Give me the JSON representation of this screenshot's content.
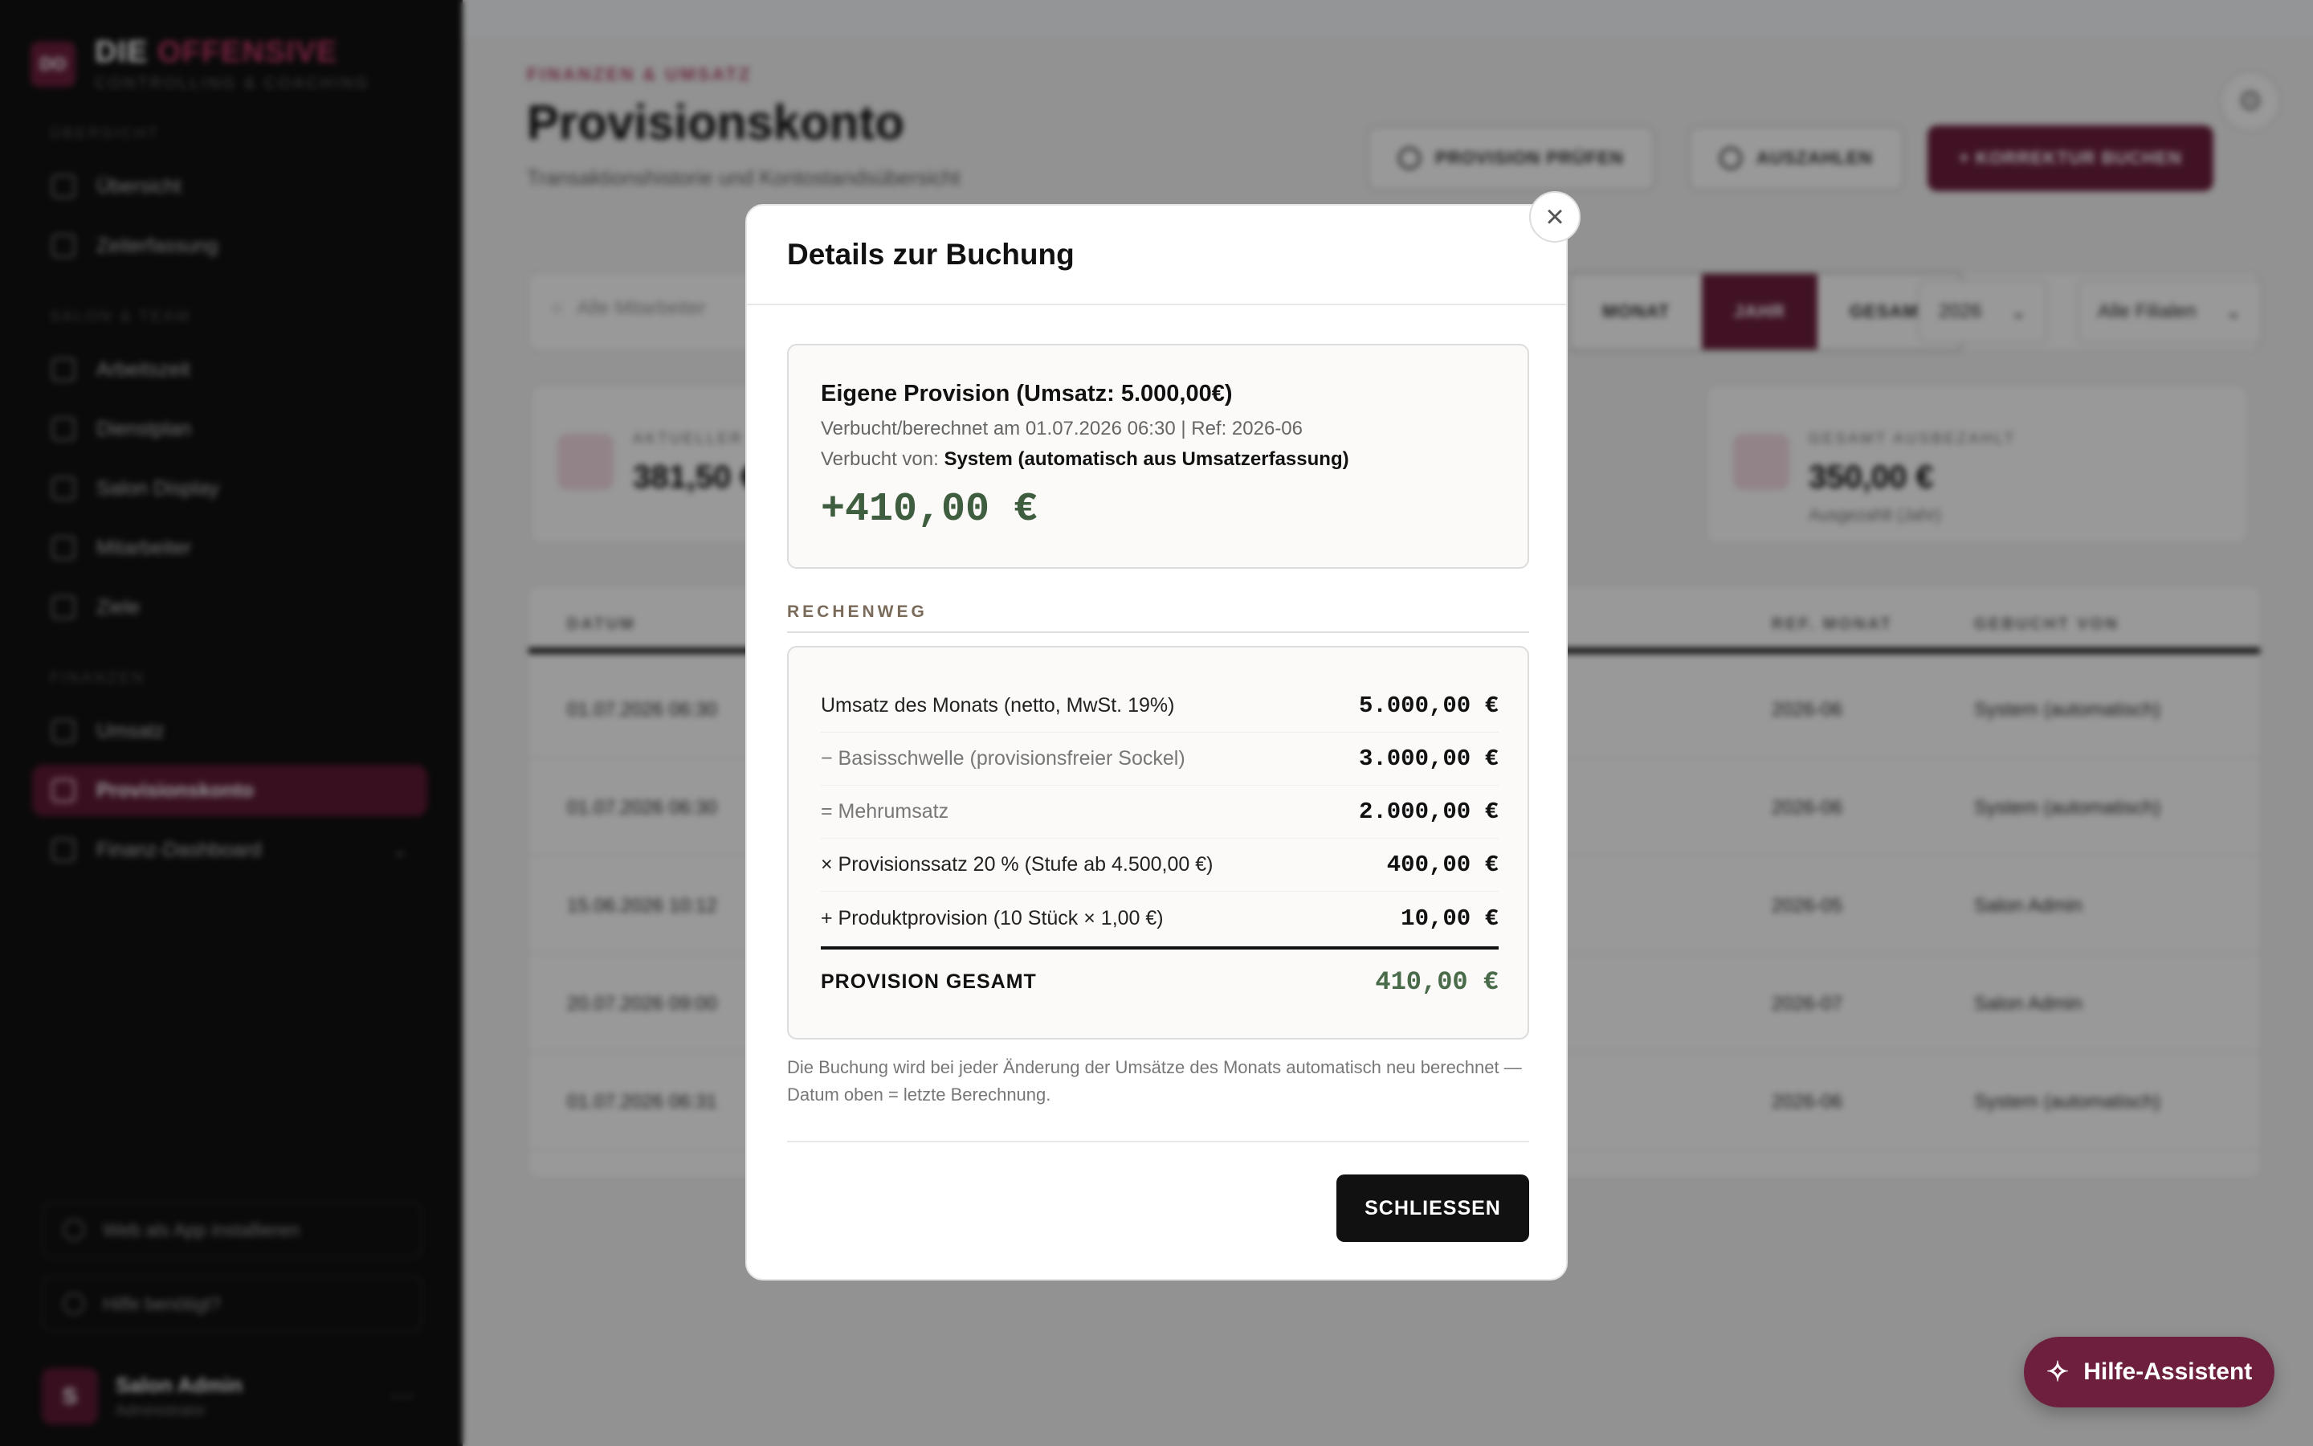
{
  "sidebar": {
    "logo_mark": "DO",
    "logo_word1": "DIE",
    "logo_word2": "OFFENSIVE",
    "logo_sub": "CONTROLLING & COACHING",
    "section1": "ÜBERSICHT",
    "section2": "SALON & TEAM",
    "section3": "FINANZEN",
    "items": [
      {
        "label": "Übersicht"
      },
      {
        "label": "Zeiterfassung"
      },
      {
        "label": "Arbeitszeit"
      },
      {
        "label": "Dienstplan"
      },
      {
        "label": "Salon Display"
      },
      {
        "label": "Mitarbeiter"
      },
      {
        "label": "Ziele"
      },
      {
        "label": "Umsatz"
      },
      {
        "label": "Provisionskonto"
      },
      {
        "label": "Finanz-Dashboard"
      }
    ],
    "install_label": "Web als App installieren",
    "help_label": "Hilfe benötigt?",
    "user_initial": "S",
    "user_name": "Salon Admin",
    "user_role": "Administrator"
  },
  "main": {
    "breadcrumb": "FINANZEN & UMSATZ",
    "title": "Provisionskonto",
    "subtitle": "Transaktionshistorie und Kontostandsübersicht",
    "btn_check": "PROVISION PRÜFEN",
    "btn_payout": "AUSZAHLEN",
    "btn_correction": "+ KORREKTUR BUCHEN",
    "search_placeholder": "Alle Mitarbeiter",
    "seg_left": "MONAT",
    "seg_active": "JAHR",
    "seg_right": "GESAMT",
    "year": "2026",
    "branch": "Alle Filialen",
    "kpi1_label": "AKTUELLER KONTOSTAND",
    "kpi1_value": "381,50 €",
    "kpi2_label": "GESAMT AUSBEZAHLT",
    "kpi2_value": "350,00 €",
    "kpi2_hint": "Ausgezahlt (Jahr)",
    "columns": [
      "DATUM",
      "REF. MONAT",
      "GEBUCHT VON"
    ],
    "rows": [
      {
        "date": "01.07.2026 06:30",
        "ref": "2026-06",
        "by": "System (automatisch)"
      },
      {
        "date": "01.07.2026 06:30",
        "ref": "2026-06",
        "by": "System (automatisch)"
      },
      {
        "date": "15.06.2026 10:12",
        "ref": "2026-05",
        "by": "Salon Admin"
      },
      {
        "date": "20.07.2026 09:00",
        "ref": "2026-07",
        "by": "Salon Admin"
      },
      {
        "date": "01.07.2026 06:31",
        "ref": "2026-06",
        "by": "System (automatisch)"
      }
    ]
  },
  "modal": {
    "title": "Details zur Buchung",
    "summary_title": "Eigene Provision (Umsatz: 5.000,00€)",
    "booked_line": "Verbucht/berechnet am 01.07.2026 06:30 | Ref: 2026-06",
    "booked_by_prefix": "Verbucht von:",
    "booked_by": "System (automatisch aus Umsatzerfassung)",
    "amount": "+410,00 €",
    "section_label": "RECHENWEG",
    "calc_rows": [
      {
        "label": "Umsatz des Monats (netto, MwSt. 19%)",
        "value": "5.000,00 €"
      },
      {
        "label": "− Basisschwelle (provisionsfreier Sockel)",
        "value": "3.000,00 €"
      },
      {
        "label": "= Mehrumsatz",
        "value": "2.000,00 €"
      },
      {
        "label": "× Provisionssatz 20 % (Stufe ab 4.500,00 €)",
        "value": "400,00 €"
      },
      {
        "label": "+ Produktprovision (10 Stück × 1,00 €)",
        "value": "10,00 €"
      }
    ],
    "total_label": "PROVISION GESAMT",
    "total_value": "410,00 €",
    "note": "Die Buchung wird bei jeder Änderung der Umsätze des Monats automatisch neu berechnet — Datum oben = letzte Berechnung.",
    "close_label": "SCHLIESSEN"
  },
  "help": {
    "label": "Hilfe-Assistent"
  },
  "colors": {
    "brand": "#6d1f3d",
    "positive": "#3f5e3f",
    "dark_button": "#111111"
  }
}
